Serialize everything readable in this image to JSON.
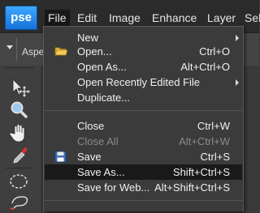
{
  "app": {
    "logo_text": "pse"
  },
  "menubar": [
    {
      "label": "File",
      "active": true
    },
    {
      "label": "Edit"
    },
    {
      "label": "Image"
    },
    {
      "label": "Enhance"
    },
    {
      "label": "Layer"
    },
    {
      "label": "Sele"
    }
  ],
  "options_bar": {
    "label": "Aspe"
  },
  "file_menu": [
    {
      "label": "New",
      "shortcut": "",
      "submenu": true
    },
    {
      "label": "Open...",
      "shortcut": "Ctrl+O",
      "icon": "folder-icon"
    },
    {
      "label": "Open As...",
      "shortcut": "Alt+Ctrl+O"
    },
    {
      "label": "Open Recently Edited File",
      "shortcut": "",
      "submenu": true
    },
    {
      "label": "Duplicate...",
      "shortcut": ""
    },
    {
      "label": "Close",
      "shortcut": "Ctrl+W"
    },
    {
      "label": "Close All",
      "shortcut": "Alt+Ctrl+W",
      "disabled": true
    },
    {
      "label": "Save",
      "shortcut": "Ctrl+S",
      "icon": "floppy-disk-icon"
    },
    {
      "label": "Save As...",
      "shortcut": "Shift+Ctrl+S",
      "highlighted": true
    },
    {
      "label": "Save for Web...",
      "shortcut": "Alt+Shift+Ctrl+S"
    }
  ],
  "toolbox": [
    "move-tool-icon",
    "zoom-tool-icon",
    "hand-tool-icon",
    "eyedropper-tool-icon",
    "marquee-tool-icon",
    "lasso-tool-icon"
  ],
  "colors": {
    "highlight": "#191919",
    "menubar_bg": "#2b2b2b",
    "logo": "#1f86ef"
  }
}
